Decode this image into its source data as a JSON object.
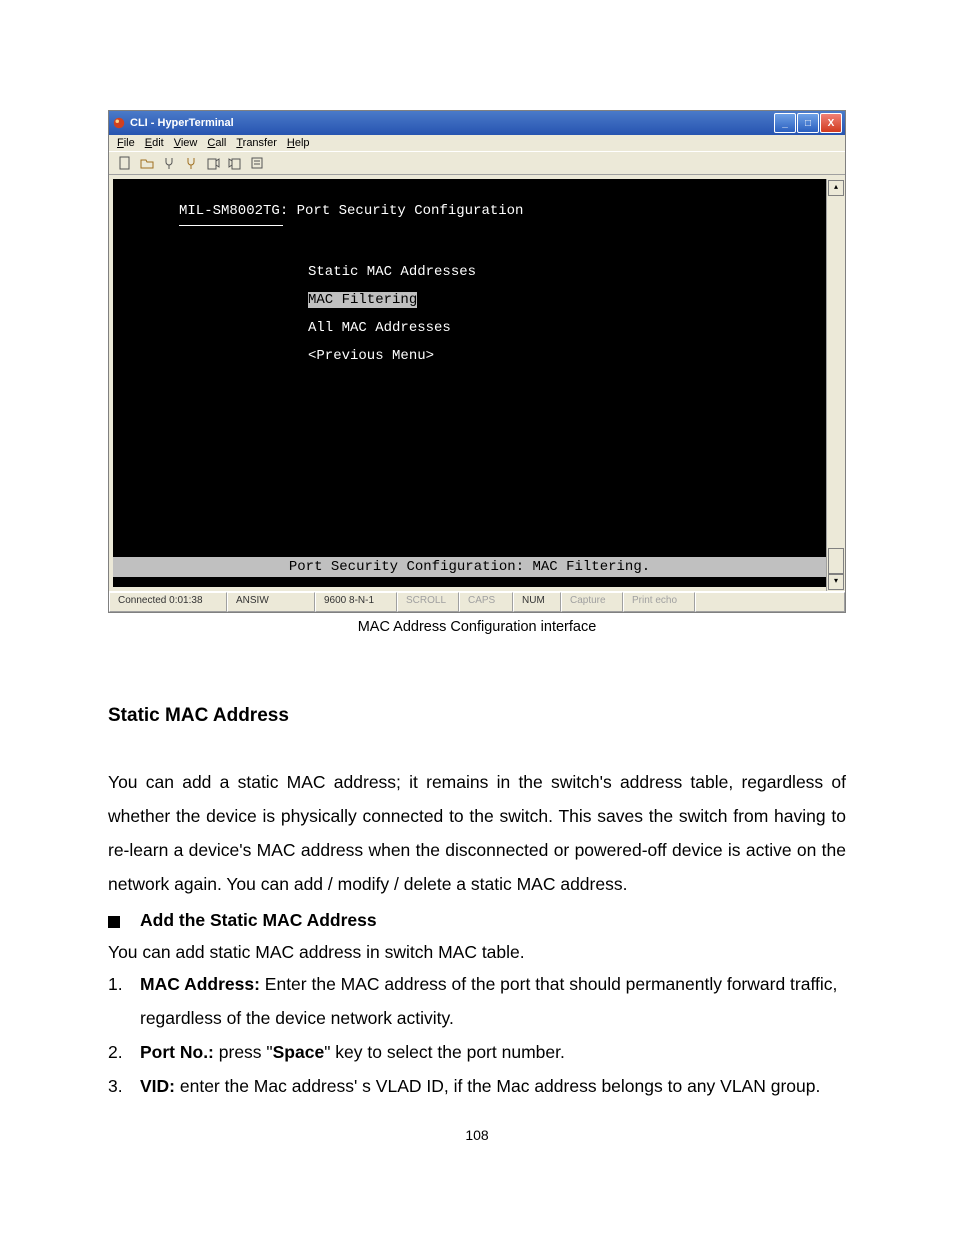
{
  "window": {
    "title": "CLI - HyperTerminal",
    "menu": {
      "file": "File",
      "edit": "Edit",
      "view": "View",
      "call": "Call",
      "transfer": "Transfer",
      "help": "Help"
    }
  },
  "terminal": {
    "header": "MIL-SM8002TG: Port Security Configuration",
    "divider": "============",
    "items": {
      "static": "Static MAC Addresses",
      "filtering": "MAC Filtering",
      "all": "All MAC Addresses",
      "prev": "<Previous Menu>"
    },
    "footer": "Port Security Configuration: MAC Filtering."
  },
  "status": {
    "connected": "Connected 0:01:38",
    "term": "ANSIW",
    "baud": "9600 8-N-1",
    "scroll": "SCROLL",
    "caps": "CAPS",
    "num": "NUM",
    "capture": "Capture",
    "echo": "Print echo"
  },
  "caption": "MAC Address Configuration interface",
  "section": {
    "heading": "Static MAC Address",
    "intro": "You can add a static MAC address; it remains in the switch's address table, regardless of whether the device is physically connected to the switch. This saves the switch from having to re-learn a device's MAC address when the disconnected or powered-off device is active on the network again. You can add / modify / delete a static MAC address.",
    "bullet": "Add the Static MAC Address",
    "bullet_desc": "You can add static MAC address in switch MAC table.",
    "list": {
      "n1": "1.",
      "i1_label": "MAC Address:",
      "i1_text": " Enter the MAC address of the port that should permanently forward traffic, regardless of the device network activity.",
      "n2": "2.",
      "i2_label": "Port No.:",
      "i2_a": " press \"",
      "i2_space": "Space",
      "i2_b": "\" key to select the port number.",
      "n3": "3.",
      "i3_label": "VID:",
      "i3_text": " enter the Mac address' s VLAD ID, if the Mac address belongs to any VLAN group."
    }
  },
  "page_number": "108"
}
